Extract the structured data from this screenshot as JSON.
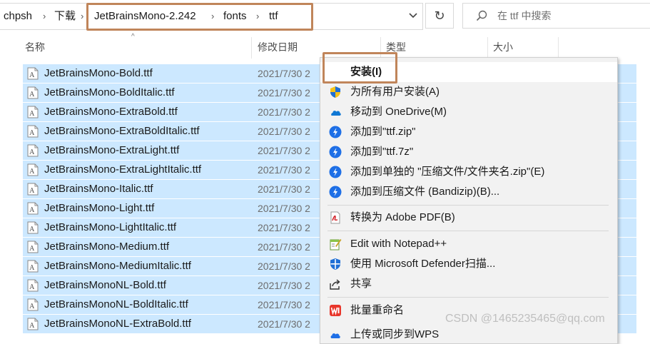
{
  "address": {
    "crumbs": [
      "chpsh",
      "下载",
      "JetBrainsMono-2.242",
      "fonts",
      "ttf"
    ],
    "separator": "›",
    "dropdown_glyph": "⌄",
    "refresh_glyph": "↻",
    "search_placeholder": "在 ttf 中搜索"
  },
  "columns": {
    "name": "名称",
    "date": "修改日期",
    "type": "类型",
    "size": "大小",
    "sort_glyph": "^"
  },
  "files": [
    {
      "name": "JetBrainsMono-Bold.ttf",
      "date": "2021/7/30 2"
    },
    {
      "name": "JetBrainsMono-BoldItalic.ttf",
      "date": "2021/7/30 2"
    },
    {
      "name": "JetBrainsMono-ExtraBold.ttf",
      "date": "2021/7/30 2"
    },
    {
      "name": "JetBrainsMono-ExtraBoldItalic.ttf",
      "date": "2021/7/30 2"
    },
    {
      "name": "JetBrainsMono-ExtraLight.ttf",
      "date": "2021/7/30 2"
    },
    {
      "name": "JetBrainsMono-ExtraLightItalic.ttf",
      "date": "2021/7/30 2"
    },
    {
      "name": "JetBrainsMono-Italic.ttf",
      "date": "2021/7/30 2"
    },
    {
      "name": "JetBrainsMono-Light.ttf",
      "date": "2021/7/30 2"
    },
    {
      "name": "JetBrainsMono-LightItalic.ttf",
      "date": "2021/7/30 2"
    },
    {
      "name": "JetBrainsMono-Medium.ttf",
      "date": "2021/7/30 2"
    },
    {
      "name": "JetBrainsMono-MediumItalic.ttf",
      "date": "2021/7/30 2"
    },
    {
      "name": "JetBrainsMonoNL-Bold.ttf",
      "date": "2021/7/30 2"
    },
    {
      "name": "JetBrainsMonoNL-BoldItalic.ttf",
      "date": "2021/7/30 2"
    },
    {
      "name": "JetBrainsMonoNL-ExtraBold.ttf",
      "date": "2021/7/30 2"
    }
  ],
  "context_menu": {
    "items": [
      {
        "label": "安装(I)",
        "icon": "none"
      },
      {
        "label": "为所有用户安装(A)",
        "icon": "uac-shield-icon"
      },
      {
        "label": "移动到 OneDrive(M)",
        "icon": "onedrive-cloud-icon"
      },
      {
        "label": "添加到\"ttf.zip\"",
        "icon": "bandizip-icon"
      },
      {
        "label": "添加到\"ttf.7z\"",
        "icon": "bandizip-icon"
      },
      {
        "label": "添加到单独的 \"压缩文件/文件夹名.zip\"(E)",
        "icon": "bandizip-icon"
      },
      {
        "label": "添加到压缩文件 (Bandizip)(B)...",
        "icon": "bandizip-icon"
      },
      {
        "label": "转换为 Adobe PDF(B)",
        "icon": "adobe-pdf-icon"
      },
      {
        "label": "Edit with Notepad++",
        "icon": "notepad-plus-plus-icon"
      },
      {
        "label": "使用 Microsoft Defender扫描...",
        "icon": "defender-icon"
      },
      {
        "label": "共享",
        "icon": "share-icon"
      },
      {
        "label": "批量重命名",
        "icon": "wps-rename-icon"
      },
      {
        "label": "上传或同步到WPS",
        "icon": "wps-upload-icon"
      }
    ]
  },
  "watermark": "CSDN @1465235465@qq.com",
  "colors": {
    "selection": "#cce8ff",
    "highlight_box": "#c0855a",
    "menu_bg": "#f2f2f2",
    "bandizip_blue": "#1e6fe6",
    "onedrive_blue": "#0f78d4",
    "pdf_red": "#d21f26",
    "wps_red": "#e8362b"
  }
}
